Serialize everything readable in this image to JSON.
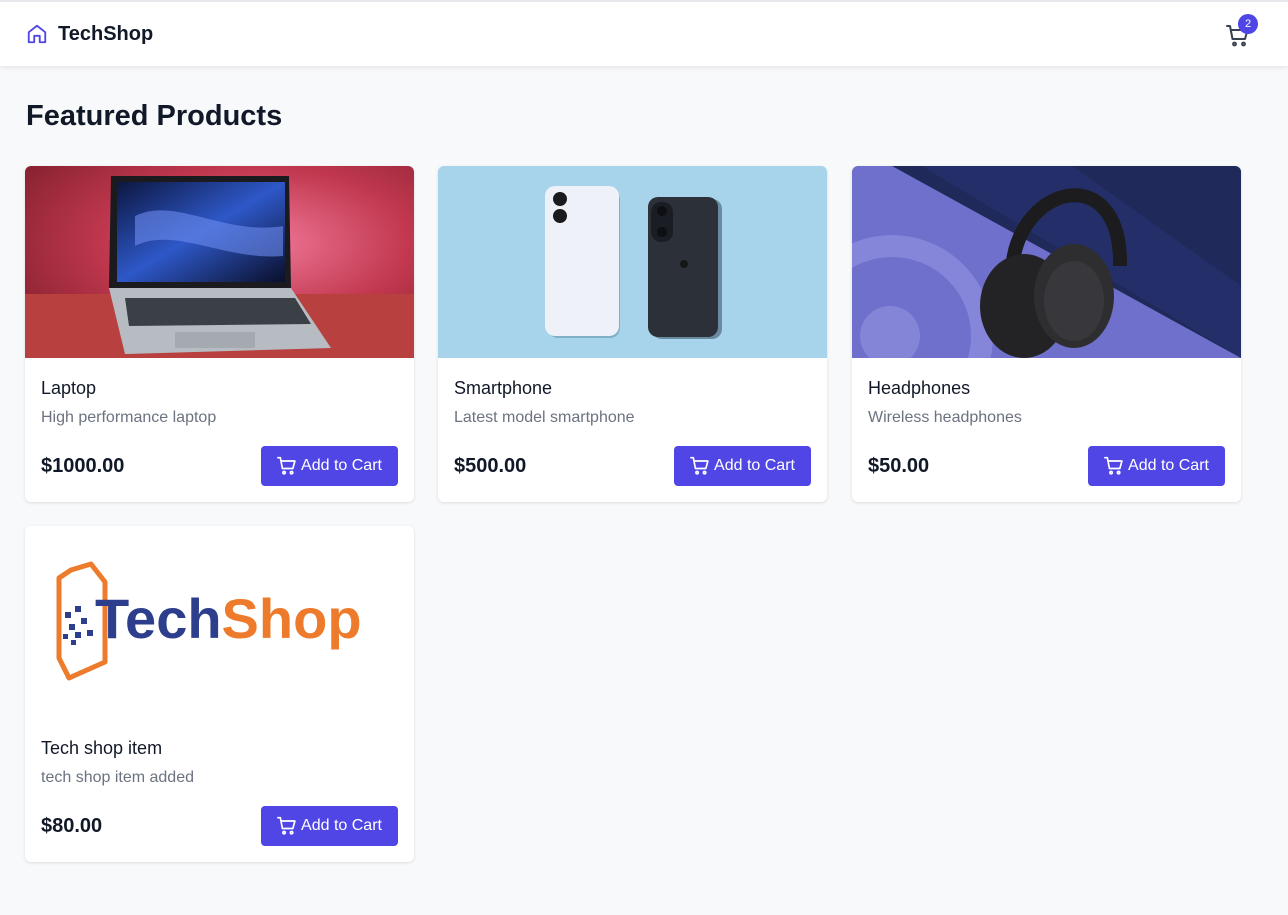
{
  "header": {
    "brand_name": "TechShop",
    "brand_icon": "home-icon",
    "cart_icon": "shopping-cart-icon",
    "cart_count": "2"
  },
  "main": {
    "title": "Featured Products",
    "products": [
      {
        "name": "Laptop",
        "description": "High performance laptop",
        "price": "$1000.00",
        "button_label": "Add to Cart"
      },
      {
        "name": "Smartphone",
        "description": "Latest model smartphone",
        "price": "$500.00",
        "button_label": "Add to Cart"
      },
      {
        "name": "Headphones",
        "description": "Wireless headphones",
        "price": "$50.00",
        "button_label": "Add to Cart"
      },
      {
        "name": "Tech shop item",
        "description": "tech shop item added",
        "price": "$80.00",
        "button_label": "Add to Cart",
        "image_logo_text": "TechShop"
      }
    ]
  },
  "colors": {
    "accent": "#4f46e5",
    "background": "#f8f9fb",
    "text_primary": "#111827",
    "text_secondary": "#6b7280"
  }
}
